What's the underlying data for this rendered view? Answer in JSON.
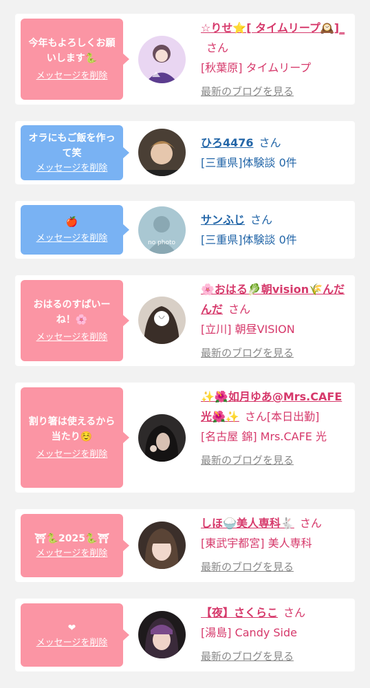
{
  "colors": {
    "pink": "#fb95a4",
    "blue": "#79b2f3",
    "name_pink": "#d6396b",
    "name_blue": "#2366a8",
    "blog_gray": "#888888"
  },
  "delete_label": "メッセージを削除",
  "san": "さん",
  "blog_label": "最新のブログを見る",
  "cards": [
    {
      "message": "今年もよろしくお願いします🐍",
      "name": "☆りせ⭐[ タイムリープ🕰️]_",
      "shop": "[秋葉原] タイムリープ"
    },
    {
      "message": "オラにもご飯を作って笑",
      "name": "ひろ4476",
      "shop": "[三重県]体験談 0件"
    },
    {
      "message": "🍎",
      "name": "サンふじ",
      "shop": "[三重県]体験談 0件",
      "avatar_text": "no photo"
    },
    {
      "message": "おはるのすぱいーね！🌸",
      "name": "🌸おはる🥬朝vision🌾んだんだ",
      "shop": "[立川] 朝昼VISION"
    },
    {
      "message": "割り箸は使えるから当たり☺️",
      "name": "✨🌺如月ゆあ@Mrs.CAFE光🌺✨",
      "status": "[本日出勤]",
      "shop": "[名古屋 錦] Mrs.CAFE 光"
    },
    {
      "message": "⛩🐍2025🐍⛩",
      "name": "しほ🍚美人専科🐇",
      "shop": "[東武宇都宮] 美人専科"
    },
    {
      "message": "❤",
      "name": "【夜】さくらこ",
      "shop": "[湯島] Candy Side"
    }
  ]
}
